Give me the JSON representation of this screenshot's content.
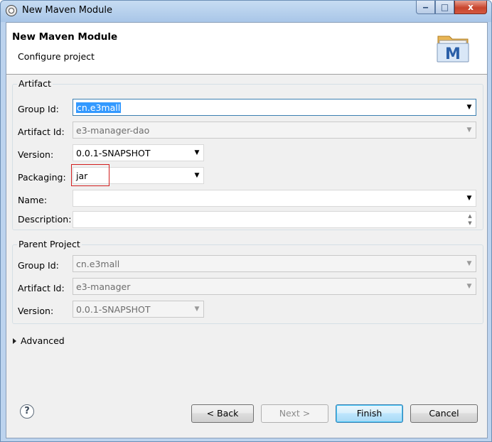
{
  "window": {
    "title": "New Maven Module",
    "icon": "eclipse-icon",
    "controls": {
      "minimize": "‒",
      "maximize": "□",
      "close": "x"
    }
  },
  "header": {
    "title": "New Maven Module",
    "subtitle": "Configure project",
    "icon": "maven-icon",
    "icon_letter": "M"
  },
  "artifact": {
    "legend": "Artifact",
    "group_id": {
      "label": "Group Id:",
      "value": "cn.e3mall"
    },
    "artifact_id": {
      "label": "Artifact Id:",
      "value": "e3-manager-dao"
    },
    "version": {
      "label": "Version:",
      "value": "0.0.1-SNAPSHOT"
    },
    "packaging": {
      "label": "Packaging:",
      "value": "jar"
    },
    "name": {
      "label": "Name:",
      "value": ""
    },
    "description": {
      "label": "Description:",
      "value": ""
    }
  },
  "parent": {
    "legend": "Parent Project",
    "group_id": {
      "label": "Group Id:",
      "value": "cn.e3mall"
    },
    "artifact_id": {
      "label": "Artifact Id:",
      "value": "e3-manager"
    },
    "version": {
      "label": "Version:",
      "value": "0.0.1-SNAPSHOT"
    }
  },
  "advanced": {
    "label": "Advanced"
  },
  "buttons": {
    "help": "?",
    "back": "< Back",
    "next": "Next >",
    "finish": "Finish",
    "cancel": "Cancel"
  },
  "colors": {
    "selection": "#3399ff",
    "highlight_box": "#d21e1e",
    "default_button": "#3c7fb1"
  }
}
